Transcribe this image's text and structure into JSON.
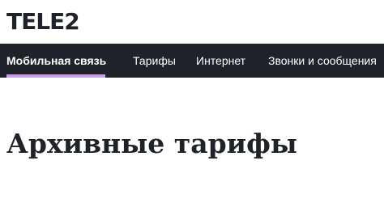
{
  "brand": {
    "logo_text": "TELE2"
  },
  "nav": {
    "items": [
      {
        "label": "Мобильная связь",
        "active": true
      },
      {
        "label": "Тарифы",
        "active": false
      },
      {
        "label": "Интернет",
        "active": false
      },
      {
        "label": "Звонки и сообщения",
        "active": false
      }
    ]
  },
  "main": {
    "title": "Архивные тарифы"
  },
  "colors": {
    "nav_background": "#1f2229",
    "active_underline": "#c89ee6",
    "text": "#1f2229"
  }
}
